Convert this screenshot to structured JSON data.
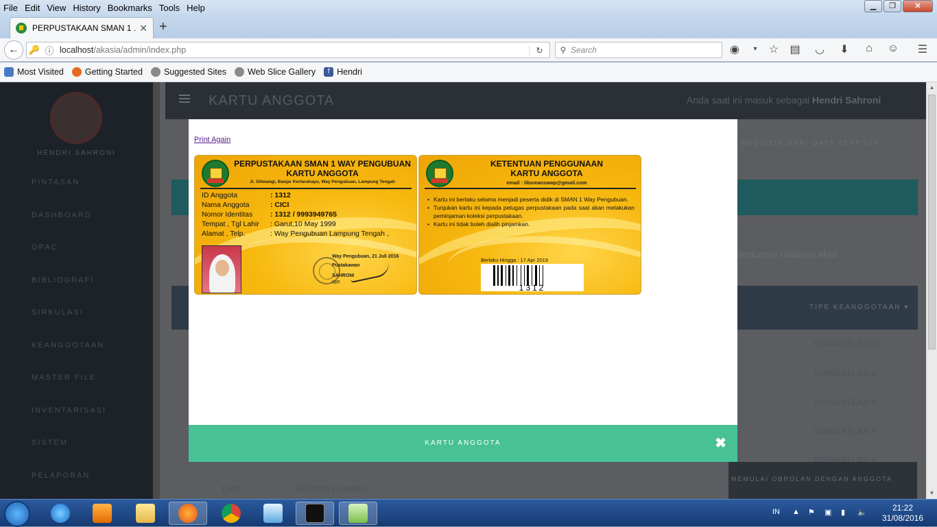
{
  "menubar": {
    "items": [
      "File",
      "Edit",
      "View",
      "History",
      "Bookmarks",
      "Tools",
      "Help"
    ]
  },
  "tab": {
    "title": "PERPUSTAKAAN SMAN 1 ..."
  },
  "nav": {
    "url_host": "localhost",
    "url_path": "/akasia/admin/index.php",
    "search_placeholder": "Search"
  },
  "bookmarks": [
    "Most Visited",
    "Getting Started",
    "Suggested Sites",
    "Web Slice Gallery",
    "Hendri"
  ],
  "app": {
    "user_name": "HENDRI SAHRONI",
    "menu": [
      "PINTASAN",
      "DASHBOARD",
      "OPAC",
      "BIBLIOGRAFI",
      "SIRKULASI",
      "KEANGGOTAAN",
      "MASTER FILE",
      "INVENTARISASI",
      "SISTEM",
      "PELAPORAN"
    ],
    "title": "KARTU ANGGOTA",
    "login_prefix": "Anda saat ini masuk sebagai",
    "login_user": "Hendri Sahroni",
    "btn_from_selected": "ANGGOTA DARI DATA TERPILIH",
    "pager_text": "Berikutnya  Halaman Akhir",
    "col_type": "TIPE KEANGGOTAAN ▾",
    "rows": [
      "SISWA KELAS XI",
      "SISWA KELAS X",
      "SISWA KELAS X",
      "SISWA KELAS X",
      "SISWA KELAS X"
    ],
    "last_row_id": "1343",
    "last_row_name": "HENDRA KUMARA",
    "start_btn": "MEMULAI OBROLAN DENGAN ANGGOTA"
  },
  "modal": {
    "print_again": "Print Again",
    "footer_title": "KARTU ANGGOTA",
    "front": {
      "head1": "PERPUSTAKAAN SMAN 1 WAY PENGUBUAN",
      "head2": "KARTU ANGGOTA",
      "address": "Jl. Siliwangi, Banjar Kertarahayu, Way Pengubuan, Lampung Tengah",
      "fields": [
        {
          "k": "ID Anggota",
          "v": ": 1312"
        },
        {
          "k": "Nama Anggota",
          "v": ": CICI"
        },
        {
          "k": "Nomor Identitas",
          "v": ": 1312 / 9993949765"
        },
        {
          "k": "Tempat , Tgl Lahir",
          "v": ": Garut,10 May 1999"
        },
        {
          "k": "Alamat , Telp.",
          "v": ": Way Pengubuan Lampung Tengah ,"
        }
      ],
      "sign_place": "Way Pengubuan, 21 Juli 2016",
      "sign_role": "Pustakawan",
      "sign_name": "SAHRONI",
      "sign_nip": "NIP."
    },
    "back": {
      "head1": "KETENTUAN PENGGUNAAN",
      "head2": "KARTU ANGGOTA",
      "email": "email : libsmansawp@gmail.com",
      "rules": [
        "Kartu ini berlaku selama menjadi peserta didik di SMAN 1 Way Pengubuan.",
        "Tunjukan kartu ini kepada petugas perpustakaan pada saat akan melakukan peminjaman koleksi perpustakaan.",
        "Kartu ini tidak boleh dialih pinjamkan."
      ],
      "valid_until": "Berlaku Hingga : 17 Apr 2019",
      "barcode_number": "1312"
    }
  },
  "tray": {
    "lang": "IN",
    "time": "21:22",
    "date": "31/08/2016"
  }
}
